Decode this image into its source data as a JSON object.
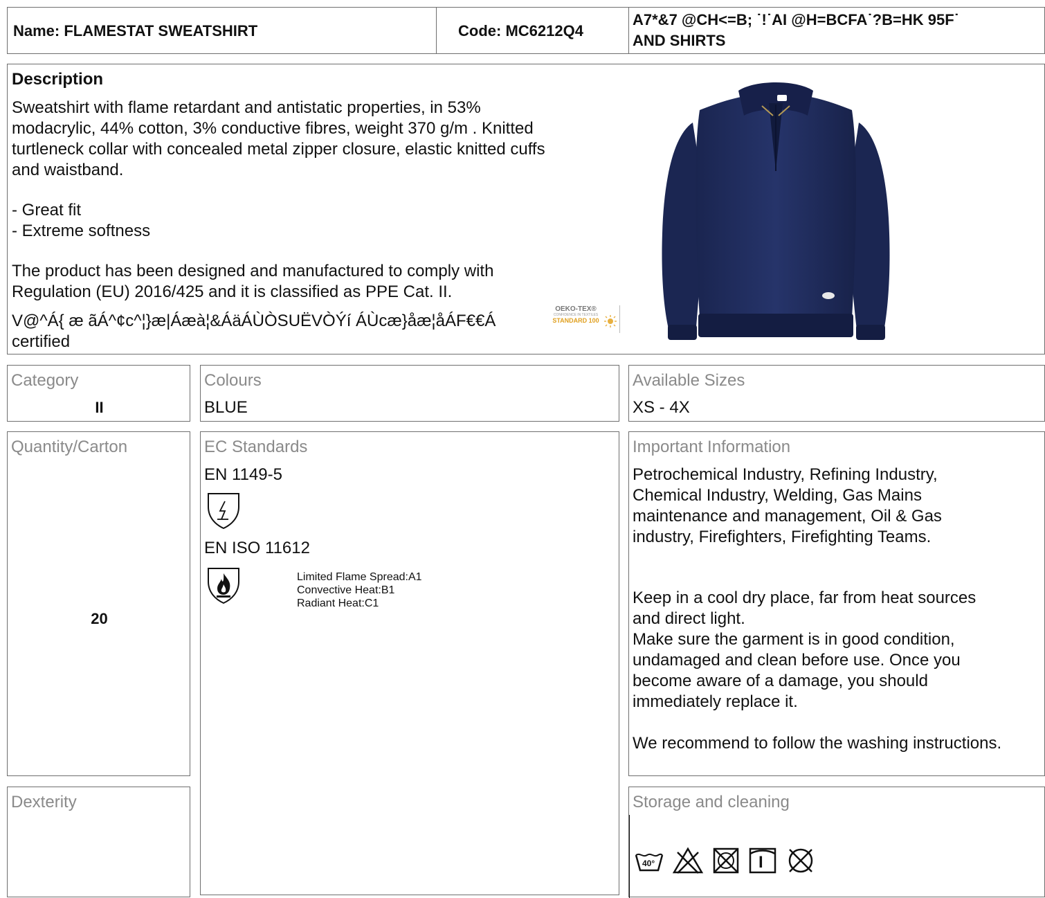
{
  "header": {
    "name": "Name: FLAMESTAT SWEATSHIRT",
    "code": "Code: MC6212Q4",
    "family_line1": "A7*&7 @CH<=B; ˙!˙AI @H=BCFA˙?B=HK 95F˙",
    "family_line2": "AND SHIRTS"
  },
  "description": {
    "heading": "Description",
    "body": [
      "Sweatshirt with flame retardant and antistatic properties, in 53%",
      "modacrylic, 44% cotton, 3% conductive fibres, weight 370 g/m . Knitted",
      "turtleneck collar with concealed metal zipper closure, elastic knitted cuffs",
      "and waistband."
    ],
    "features": [
      "- Great fit",
      "- Extreme softness"
    ],
    "regulation": [
      "The product has been designed and manufactured to comply with",
      "Regulation (EU) 2016/425 and it is classified as PPE Cat. II."
    ],
    "garbled_line": "V@^Á{ æ ãÁ^¢c^¦}æ|Áæà¦&ÁäÁÙÒSUËVÒÝí ÁÙcæ}åæ¦åÁF€€Á",
    "certified": "certified",
    "oeko_logo": {
      "line1": "OEKO-TEX®",
      "line2": "CONFIDENCE IN TEXTILES",
      "line3": "STANDARD 100"
    }
  },
  "product_image": {
    "color": "#1e2b55"
  },
  "category": {
    "label": "Category",
    "value": "II"
  },
  "colours": {
    "label": "Colours",
    "value": "BLUE"
  },
  "sizes": {
    "label": "Available Sizes",
    "value": "XS - 4X"
  },
  "quantity": {
    "label": "Quantity/Carton",
    "value": "20"
  },
  "standards": {
    "label": "EC Standards",
    "items": [
      {
        "code": "EN 1149-5",
        "details": []
      },
      {
        "code": "EN ISO 11612",
        "details": [
          "Limited Flame Spread:A1",
          "Convective Heat:B1",
          "Radiant Heat:C1"
        ]
      }
    ]
  },
  "important": {
    "label": "Important Information",
    "industries": [
      "Petrochemical Industry, Refining Industry,",
      "Chemical Industry, Welding, Gas Mains",
      "maintenance and management, Oil & Gas",
      "industry, Firefighters, Firefighting Teams."
    ],
    "care": [
      "Keep in a cool dry place, far from heat sources",
      "and direct light.",
      "Make sure the garment is in good condition,",
      "undamaged and clean before use. Once you",
      "become aware of a damage, you should",
      "immediately replace it."
    ],
    "recommend": "We recommend to follow the washing instructions."
  },
  "dexterity": {
    "label": "Dexterity"
  },
  "storage": {
    "label": "Storage and cleaning",
    "wash_temp": "40°",
    "icons": [
      "wash-40-icon",
      "no-bleach-icon",
      "no-tumble-dry-icon",
      "line-dry-icon",
      "no-dry-clean-icon"
    ],
    "line_dry_mark": "I"
  }
}
